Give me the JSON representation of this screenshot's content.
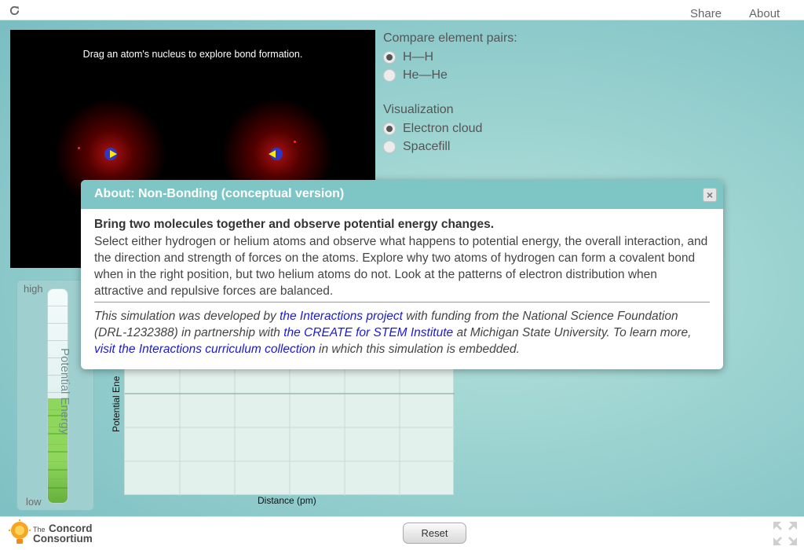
{
  "topbar": {
    "share_label": "Share",
    "about_label": "About",
    "reload_icon": "reload-icon"
  },
  "simulation": {
    "instruction": "Drag an atom's nucleus to explore bond formation."
  },
  "compare": {
    "title": "Compare element pairs:",
    "options": [
      {
        "label": "H—H",
        "selected": true
      },
      {
        "label": "He—He",
        "selected": false
      }
    ]
  },
  "visualization": {
    "title": "Visualization",
    "options": [
      {
        "label": "Electron cloud",
        "selected": true
      },
      {
        "label": "Spacefill",
        "selected": false
      }
    ]
  },
  "energy_bar": {
    "high_label": "high",
    "low_label": "low",
    "label": "Potential Energy",
    "level": 0.49
  },
  "graph": {
    "ylabel": "Potential Ene",
    "xlabel": "Distance (pm)"
  },
  "modal": {
    "title": "About: Non-Bonding (conceptual version)",
    "close_icon": "close-icon",
    "heading": "Bring two molecules together and observe potential energy changes.",
    "text": "Select either hydrogen or helium atoms and observe what happens to potential energy, the overall interaction, and the direction and strength of forces on the atoms. Explore why two atoms of hydrogen can form a covalent bond when in the right position, but two helium atoms do not. Look at the patterns of electron distribution when attractive and repulsive forces are balanced.",
    "credits": {
      "part1": "This simulation was developed by ",
      "link1": "the Interactions project",
      "part2": " with funding from the National Science Foundation (DRL-1232388) in partnership with ",
      "link2": "the CREATE for STEM Institute",
      "part3": " at Michigan State University. To learn more, ",
      "link3": "visit the Interactions curriculum collection",
      "part4": " in which this simulation is embedded."
    }
  },
  "bottombar": {
    "logo_small": "The",
    "logo_line1": "Concord",
    "logo_line2": "Consortium",
    "reset_label": "Reset",
    "fullscreen_icon": "fullscreen-icon"
  }
}
